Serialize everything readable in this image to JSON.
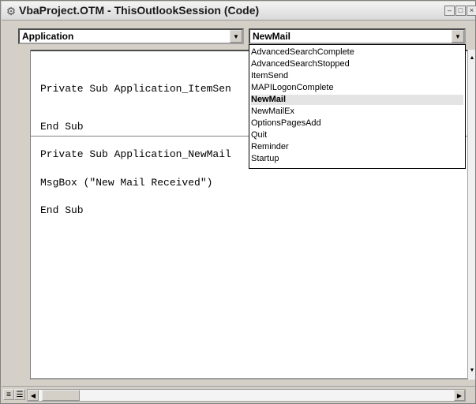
{
  "window": {
    "title": "VbaProject.OTM - ThisOutlookSession (Code)",
    "icon": "vba-project-icon",
    "controls": [
      "minimize-icon",
      "restore-icon",
      "close-icon"
    ]
  },
  "object_combo": {
    "value": "Application"
  },
  "procedure_combo": {
    "value": "NewMail"
  },
  "procedure_list": {
    "items": [
      "AdvancedSearchComplete",
      "AdvancedSearchStopped",
      "ItemSend",
      "MAPILogonComplete",
      "NewMail",
      "NewMailEx",
      "OptionsPagesAdd",
      "Quit",
      "Reminder",
      "Startup"
    ],
    "selected": "NewMail"
  },
  "code": {
    "lines": [
      "Private Sub Application_ItemSen",
      "End Sub",
      "Private Sub Application_NewMail",
      "MsgBox (\"New Mail Received\")",
      "End Sub"
    ]
  },
  "colors": {
    "window_bg": "#d4d0c8",
    "editor_bg": "#ffffff",
    "list_selected_bg": "#e4e4e4"
  }
}
